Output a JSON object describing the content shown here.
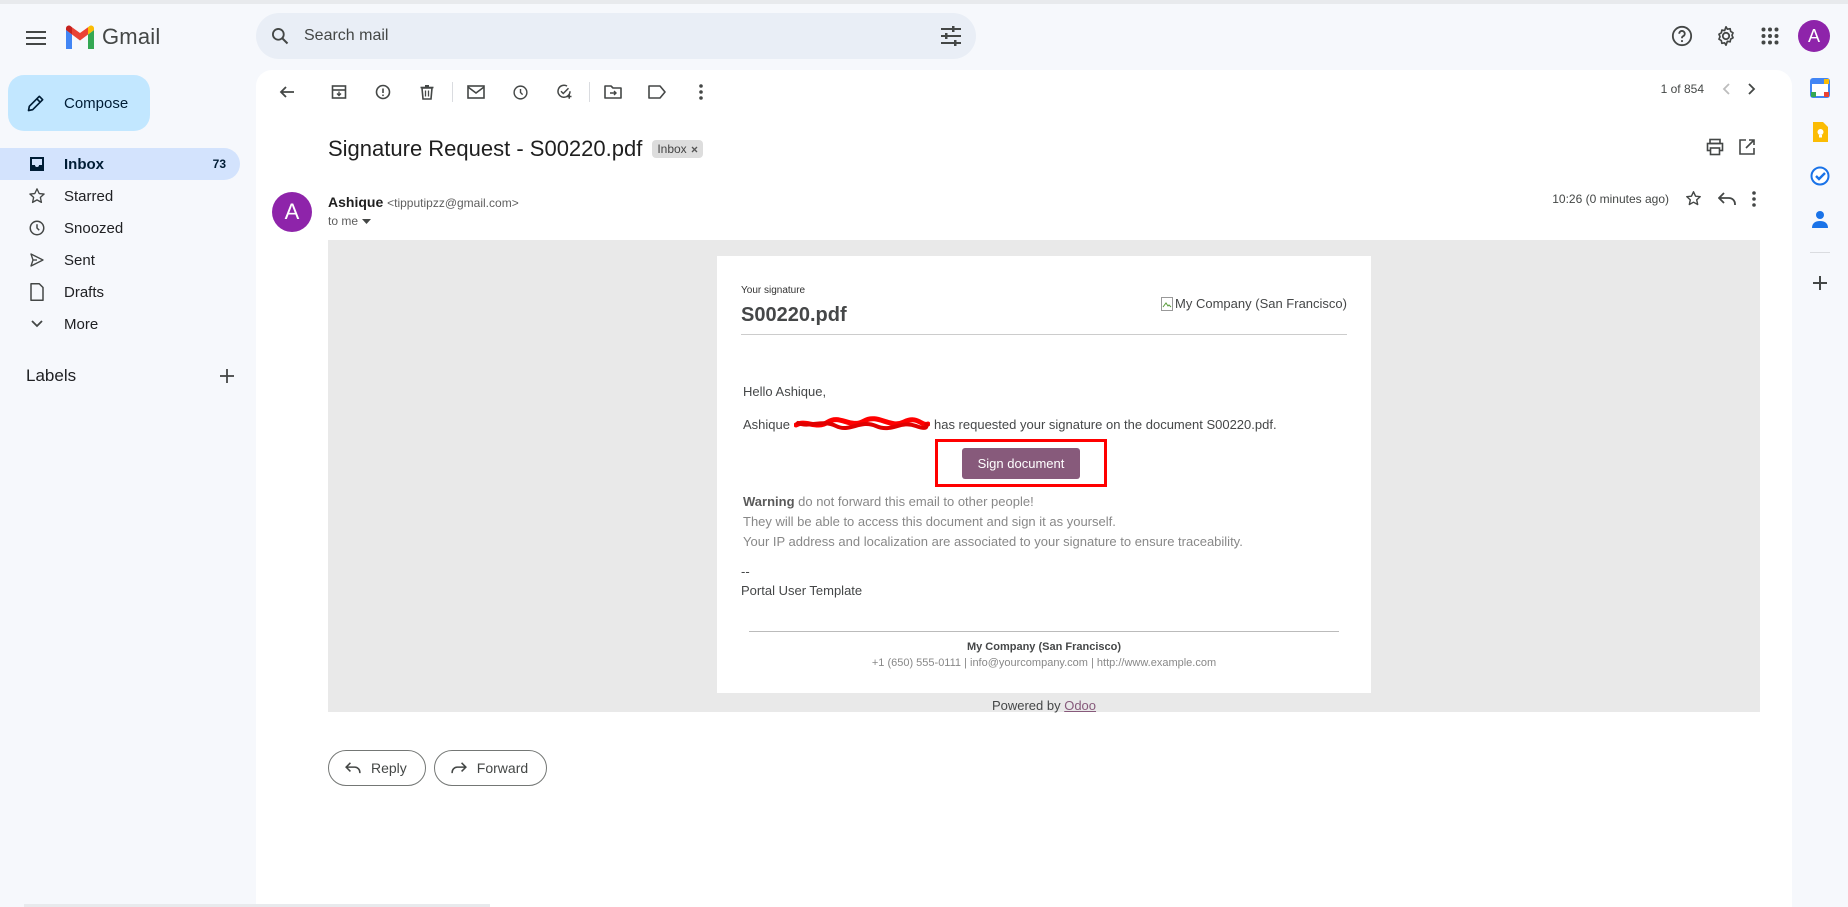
{
  "app": {
    "name": "Gmail",
    "account_initial": "A"
  },
  "search": {
    "placeholder": "Search mail"
  },
  "compose_label": "Compose",
  "nav": {
    "items": [
      {
        "label": "Inbox",
        "count": "73",
        "icon": "inbox-icon"
      },
      {
        "label": "Starred",
        "count": "",
        "icon": "star-icon"
      },
      {
        "label": "Snoozed",
        "count": "",
        "icon": "clock-icon"
      },
      {
        "label": "Sent",
        "count": "",
        "icon": "send-icon"
      },
      {
        "label": "Drafts",
        "count": "",
        "icon": "draft-icon"
      },
      {
        "label": "More",
        "count": "",
        "icon": "chevron-down-icon"
      }
    ],
    "labels_title": "Labels"
  },
  "paging": {
    "text": "1 of 854"
  },
  "message": {
    "subject": "Signature Request - S00220.pdf",
    "label_chip": "Inbox",
    "sender_initial": "A",
    "sender_name": "Ashique",
    "sender_email": "<tipputipzz@gmail.com>",
    "to": "to me",
    "time": "10:26 (0 minutes ago)"
  },
  "email": {
    "your_signature": "Your signature",
    "document": "S00220.pdf",
    "company_image_alt": "My Company (San Francisco)",
    "greeting": "Hello Ashique,",
    "requester": "Ashique",
    "request_text": "has requested your signature on the document S00220.pdf.",
    "sign_button": "Sign document",
    "warning_bold": "Warning",
    "warning_1": " do not forward this email to other people!",
    "warning_2": "They will be able to access this document and sign it as yourself.",
    "warning_3": "Your IP address and localization are associated to your signature to ensure traceability.",
    "dash": "--",
    "signature_template": "Portal User Template",
    "footer_company": "My Company (San Francisco)",
    "footer_contact": "+1 (650) 555-0111 | info@yourcompany.com | http://www.example.com",
    "powered_prefix": "Powered by ",
    "powered_link": "Odoo"
  },
  "actions": {
    "reply": "Reply",
    "forward": "Forward"
  },
  "colors": {
    "accent": "#c2e7ff",
    "odoo": "#875a7b",
    "highlight": "#ff0000"
  }
}
